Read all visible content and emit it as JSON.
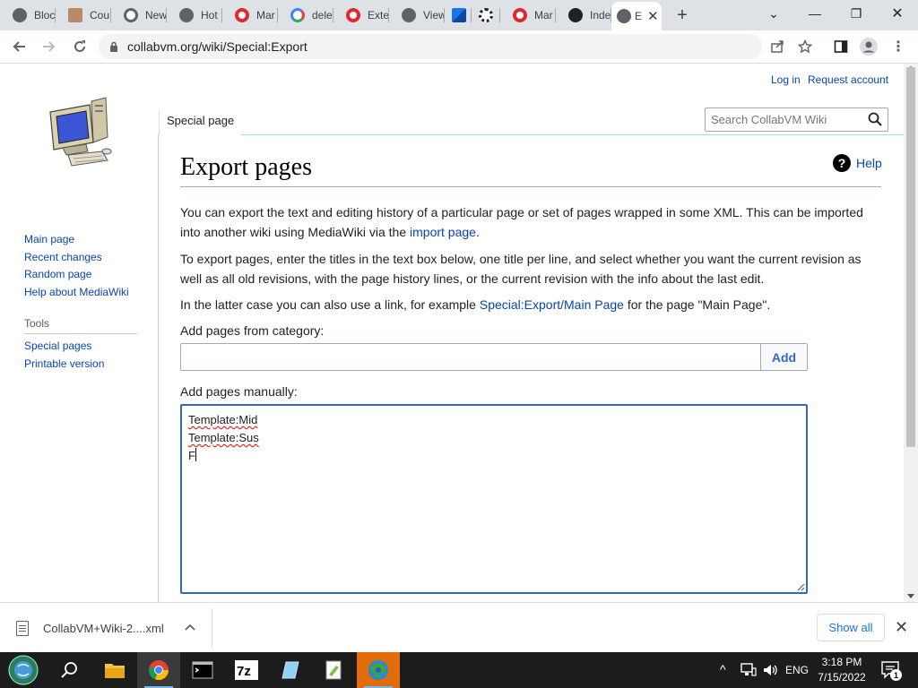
{
  "browser": {
    "tabs": [
      {
        "label": "Bloc",
        "icon": "globe-icon"
      },
      {
        "label": "Cou",
        "icon": "avatar-icon"
      },
      {
        "label": "New",
        "icon": "chrome-icon"
      },
      {
        "label": "Hot",
        "icon": "globe-icon"
      },
      {
        "label": "Mar",
        "icon": "opera-icon"
      },
      {
        "label": "dele",
        "icon": "google-icon"
      },
      {
        "label": "Exte",
        "icon": "opera-icon"
      },
      {
        "label": "View",
        "icon": "globe-icon"
      },
      {
        "label": "",
        "icon": "pinwheel-icon"
      },
      {
        "label": "",
        "icon": "ship-wheel-icon"
      },
      {
        "label": "Mar",
        "icon": "opera-icon"
      },
      {
        "label": "Inde",
        "icon": "wiki-w-icon"
      },
      {
        "label": "E",
        "icon": "globe-icon",
        "active": true
      }
    ],
    "url": "collabvm.org/wiki/Special:Export"
  },
  "personal": {
    "login": "Log in",
    "request": "Request account"
  },
  "sidebar": {
    "nav": [
      "Main page",
      "Recent changes",
      "Random page",
      "Help about MediaWiki"
    ],
    "tools_heading": "Tools",
    "tools": [
      "Special pages",
      "Printable version"
    ]
  },
  "page_tab": "Special page",
  "search": {
    "placeholder": "Search CollabVM Wiki"
  },
  "content": {
    "title": "Export pages",
    "help": "Help",
    "p1_before": "You can export the text and editing history of a particular page or set of pages wrapped in some XML. This can be imported into another wiki using MediaWiki via the",
    "p1_link": "import page",
    "p1_after": ".",
    "p2": "To export pages, enter the titles in the text box below, one title per line, and select whether you want the current revision as well as all old revisions, with the page history lines, or the current revision with the info about the last edit.",
    "p3_before": "In the latter case you can also use a link, for example",
    "p3_link": "Special:Export/Main Page",
    "p3_after": "for the page \"Main Page\".",
    "category_label": "Add pages from category:",
    "category_value": "",
    "add_button": "Add",
    "manual_label": "Add pages manually:",
    "manual_lines": [
      "Template:Mid",
      "Template:Sus",
      "F"
    ]
  },
  "downloads": {
    "file": "CollabVM+Wiki-2....xml",
    "show_all": "Show all"
  },
  "taskbar": {
    "lang": "ENG",
    "time": "3:18 PM",
    "date": "7/15/2022",
    "notif_count": "1"
  },
  "colors": {
    "link": "#0645ad",
    "focus": "#3366cc",
    "tabstrip": "#dee1e6"
  }
}
